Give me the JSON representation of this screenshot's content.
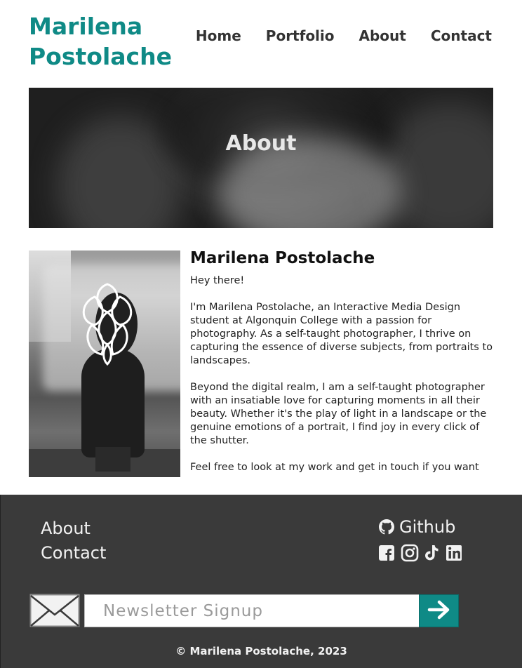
{
  "header": {
    "logo_line1": "Marilena",
    "logo_line2": "Postolache",
    "nav": {
      "home": "Home",
      "portfolio": "Portfolio",
      "about": "About",
      "contact": "Contact"
    }
  },
  "hero": {
    "title": "About"
  },
  "about": {
    "heading": "Marilena Postolache",
    "paragraphs": [
      "Hey there!",
      "I'm Marilena Postolache, an Interactive Media Design student at Algonquin College with a passion for photography. As a self-taught photographer, I thrive on capturing the essence of diverse subjects, from portraits to landscapes.",
      "Beyond the digital realm, I am a self-taught photographer with an insatiable love for capturing moments in all their beauty. Whether it's the play of light in a landscape or the genuine emotions of a portrait, I find joy in every click of the shutter.",
      "Feel free to look at my work and get in touch if you want"
    ]
  },
  "footer": {
    "links": {
      "about": "About",
      "contact": "Contact"
    },
    "github_label": "Github",
    "social_icons": [
      "facebook-icon",
      "instagram-icon",
      "tiktok-icon",
      "linkedin-icon"
    ],
    "newsletter_placeholder": "Newsletter Signup",
    "copyright": "© Marilena Postolache, 2023"
  },
  "colors": {
    "accent": "#0f8a86",
    "footer_bg": "#3a3a3a",
    "text": "#222222"
  }
}
